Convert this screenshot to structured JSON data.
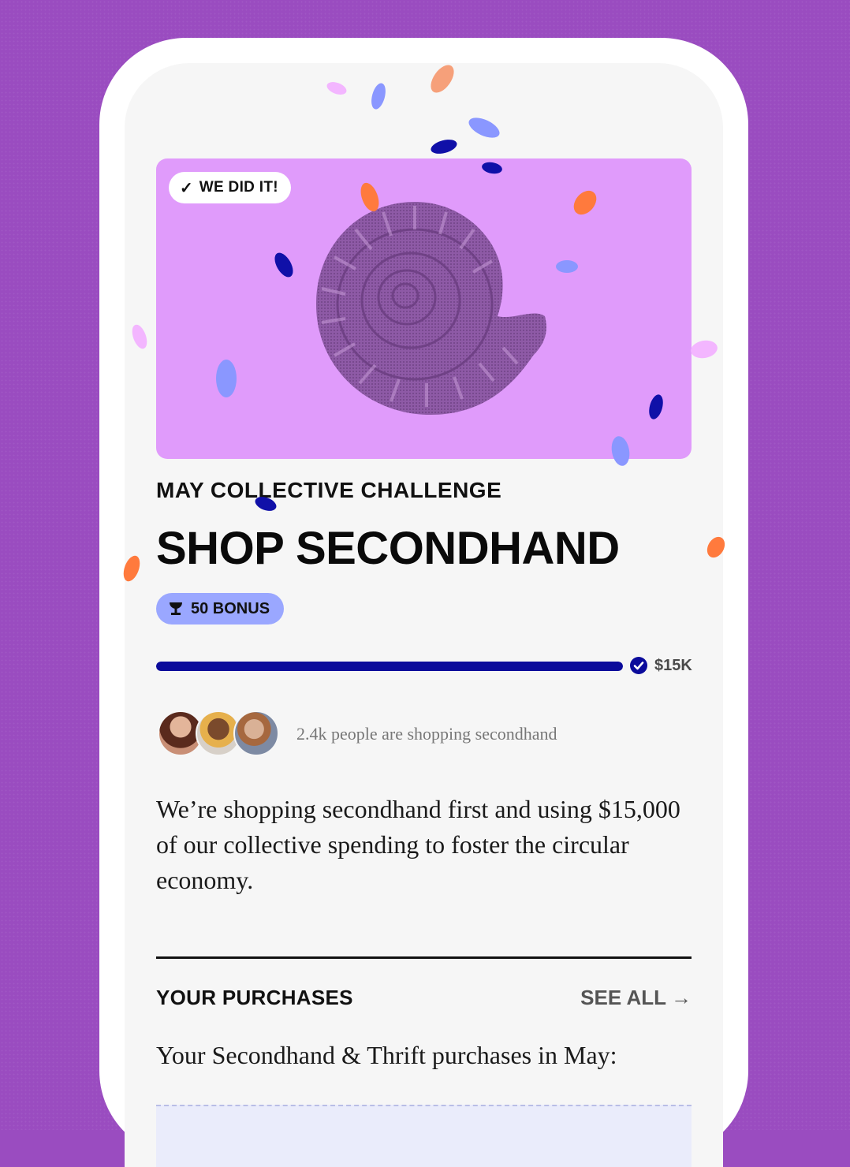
{
  "hero": {
    "badge_label": "WE DID IT!"
  },
  "challenge": {
    "eyebrow": "MAY COLLECTIVE CHALLENGE",
    "title": "SHOP SECONDHAND",
    "bonus_label": "50 BONUS",
    "progress_fraction": 1.0,
    "goal_label": "$15K"
  },
  "participants": {
    "text": "2.4k people are shopping secondhand"
  },
  "description": "We’re shopping secondhand first and using $15,000 of our collective spending to foster the circular economy.",
  "purchases": {
    "section_label": "YOUR PURCHASES",
    "see_all_label": "SEE ALL",
    "subtitle": "Your Secondhand & Thrift purchases in May:"
  },
  "colors": {
    "background": "#9a4cc0",
    "hero_bg": "#e09bfb",
    "progress": "#0b0b9b",
    "bonus_pill": "#9aa7ff",
    "confetti": [
      "#ff7a3d",
      "#f6a07a",
      "#8a97ff",
      "#1010a8",
      "#f3b6ff"
    ]
  },
  "icons": [
    "check-icon",
    "trophy-icon",
    "check-circle-icon",
    "arrow-right-icon"
  ]
}
